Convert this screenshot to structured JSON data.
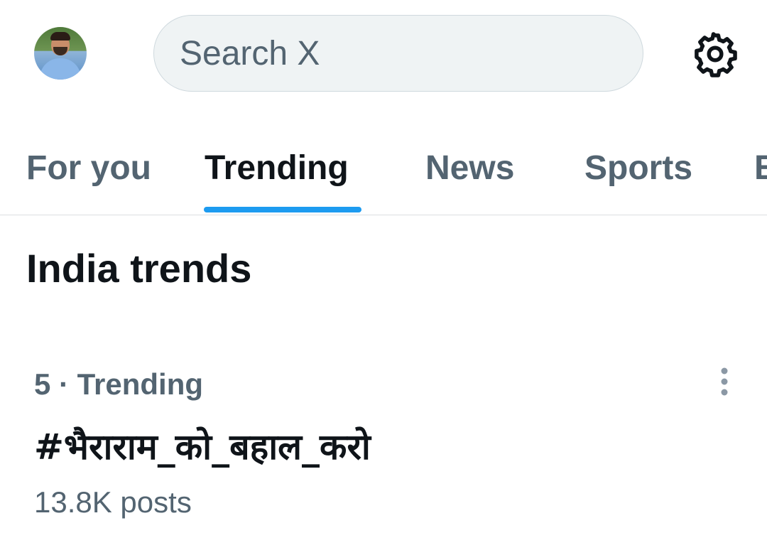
{
  "header": {
    "search_placeholder": "Search X",
    "avatar_icon": "profile-photo",
    "settings_icon": "gear-icon"
  },
  "tabs": [
    {
      "label": "For you",
      "active": false
    },
    {
      "label": "Trending",
      "active": true
    },
    {
      "label": "News",
      "active": false
    },
    {
      "label": "Sports",
      "active": false
    },
    {
      "label": "E",
      "active": false
    }
  ],
  "section": {
    "title": "India trends"
  },
  "trends": [
    {
      "meta": "5 · Trending",
      "title": "#भैराराम_को_बहाल_करो",
      "count": "13.8K posts",
      "more_icon": "more-vertical-icon"
    }
  ],
  "colors": {
    "accent": "#1d9bf0",
    "text_primary": "#0f1419",
    "text_secondary": "#536471",
    "search_bg": "#eff3f4"
  }
}
